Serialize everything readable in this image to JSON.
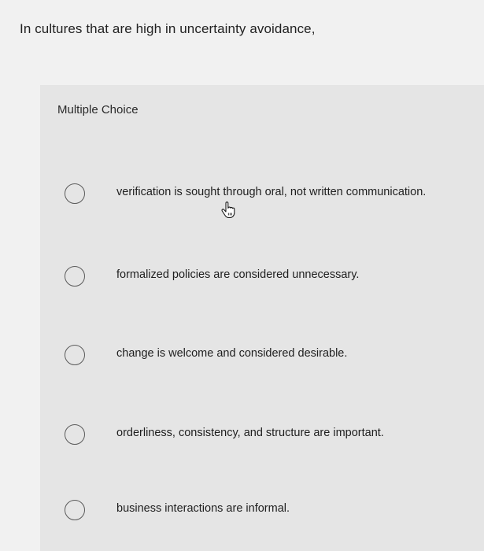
{
  "question": {
    "text": "In cultures that are high in uncertainty avoidance,"
  },
  "card": {
    "type_label": "Multiple Choice"
  },
  "options": [
    {
      "label": "verification is sought through oral, not written communication.",
      "selected": false
    },
    {
      "label": "formalized policies are considered unnecessary.",
      "selected": false
    },
    {
      "label": "change is welcome and considered desirable.",
      "selected": false
    },
    {
      "label": "orderliness, consistency, and structure are important.",
      "selected": false
    },
    {
      "label": "business interactions are informal.",
      "selected": false
    }
  ],
  "icons": {
    "option_marker": "radio-unchecked-icon",
    "pointer": "hand-pointer-icon"
  }
}
